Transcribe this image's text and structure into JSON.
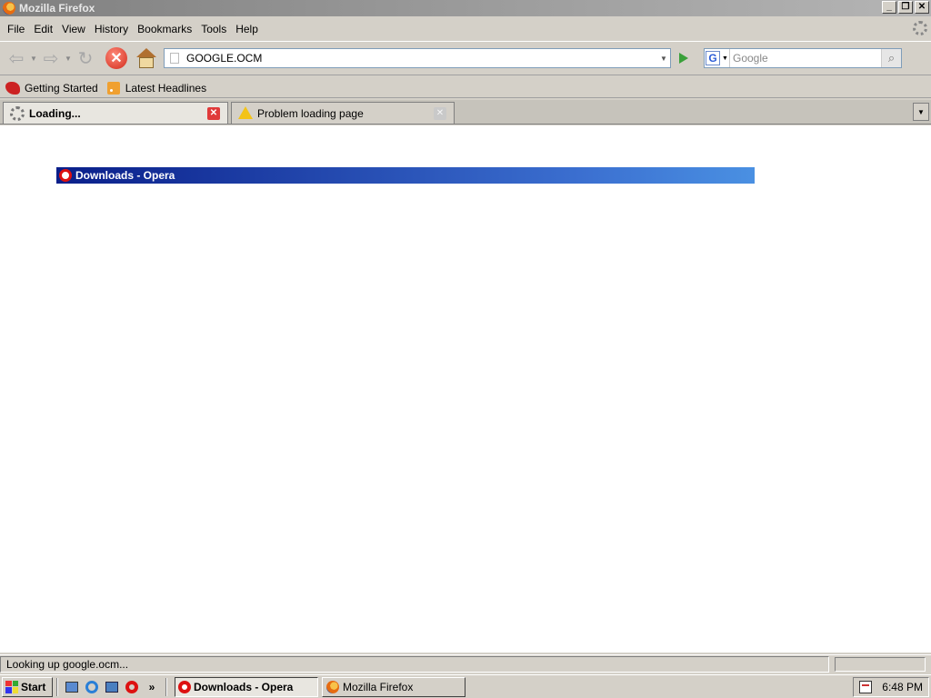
{
  "window": {
    "title": "Mozilla Firefox",
    "buttons": [
      "_",
      "❐",
      "✕"
    ]
  },
  "menu": {
    "items": [
      "File",
      "Edit",
      "View",
      "History",
      "Bookmarks",
      "Tools",
      "Help"
    ]
  },
  "nav": {
    "back_icon": "back-arrow-icon",
    "forward_icon": "forward-arrow-icon",
    "reload_icon": "reload-icon",
    "stop_icon": "stop-icon",
    "home_icon": "home-icon",
    "url": "GOOGLE.OCM",
    "search_engine": "G",
    "search_placeholder": "Google"
  },
  "bookmarks": [
    {
      "label": "Getting Started",
      "icon": "firefox-bookmark-icon"
    },
    {
      "label": "Latest Headlines",
      "icon": "rss-icon"
    }
  ],
  "tabs": [
    {
      "label": "Loading...",
      "active": true,
      "icon": "spinner-icon"
    },
    {
      "label": "Problem loading page",
      "active": false,
      "icon": "warning-icon"
    }
  ],
  "content": {
    "dragged_window_title": "Downloads - Opera"
  },
  "status": {
    "text": "Looking up google.ocm..."
  },
  "taskbar": {
    "start_label": "Start",
    "quicklaunch_more": "»",
    "buttons": [
      {
        "label": "Downloads - Opera",
        "pressed": true
      },
      {
        "label": "Mozilla Firefox",
        "pressed": false
      }
    ],
    "clock": "6:48 PM"
  }
}
